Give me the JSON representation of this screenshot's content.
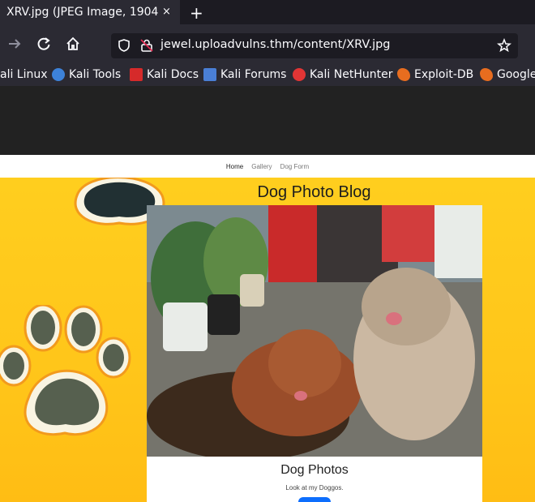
{
  "browser": {
    "tab_title": "XRV.jpg (JPEG Image, 1904",
    "tab_close": "×",
    "new_tab": "+",
    "url": "jewel.uploadvulns.thm/content/XRV.jpg",
    "icons": [
      "back-arrow-icon",
      "reload-icon",
      "home-icon",
      "shield-icon",
      "lock-icon",
      "star-icon"
    ]
  },
  "bookmarks": [
    {
      "label": "ali Linux",
      "icon": "kali-icon"
    },
    {
      "label": "Kali Tools",
      "icon": "kali-tools-icon"
    },
    {
      "label": "Kali Docs",
      "icon": "kali-docs-icon"
    },
    {
      "label": "Kali Forums",
      "icon": "kali-forums-icon"
    },
    {
      "label": "Kali NetHunter",
      "icon": "kali-nethunter-icon"
    },
    {
      "label": "Exploit-DB",
      "icon": "exploit-db-icon"
    },
    {
      "label": "Google",
      "icon": "google-hacking-icon"
    }
  ],
  "site": {
    "nav": [
      "Home",
      "Gallery",
      "Dog Form"
    ],
    "title": "Dog Photo Blog",
    "card_title": "Dog Photos",
    "card_subtitle": "Look at my Doggos."
  },
  "colors": {
    "chrome_dark": "#1c1b22",
    "chrome": "#2b2a33",
    "page_yellow": "#ffc61a",
    "button_blue": "#0d6efd"
  }
}
